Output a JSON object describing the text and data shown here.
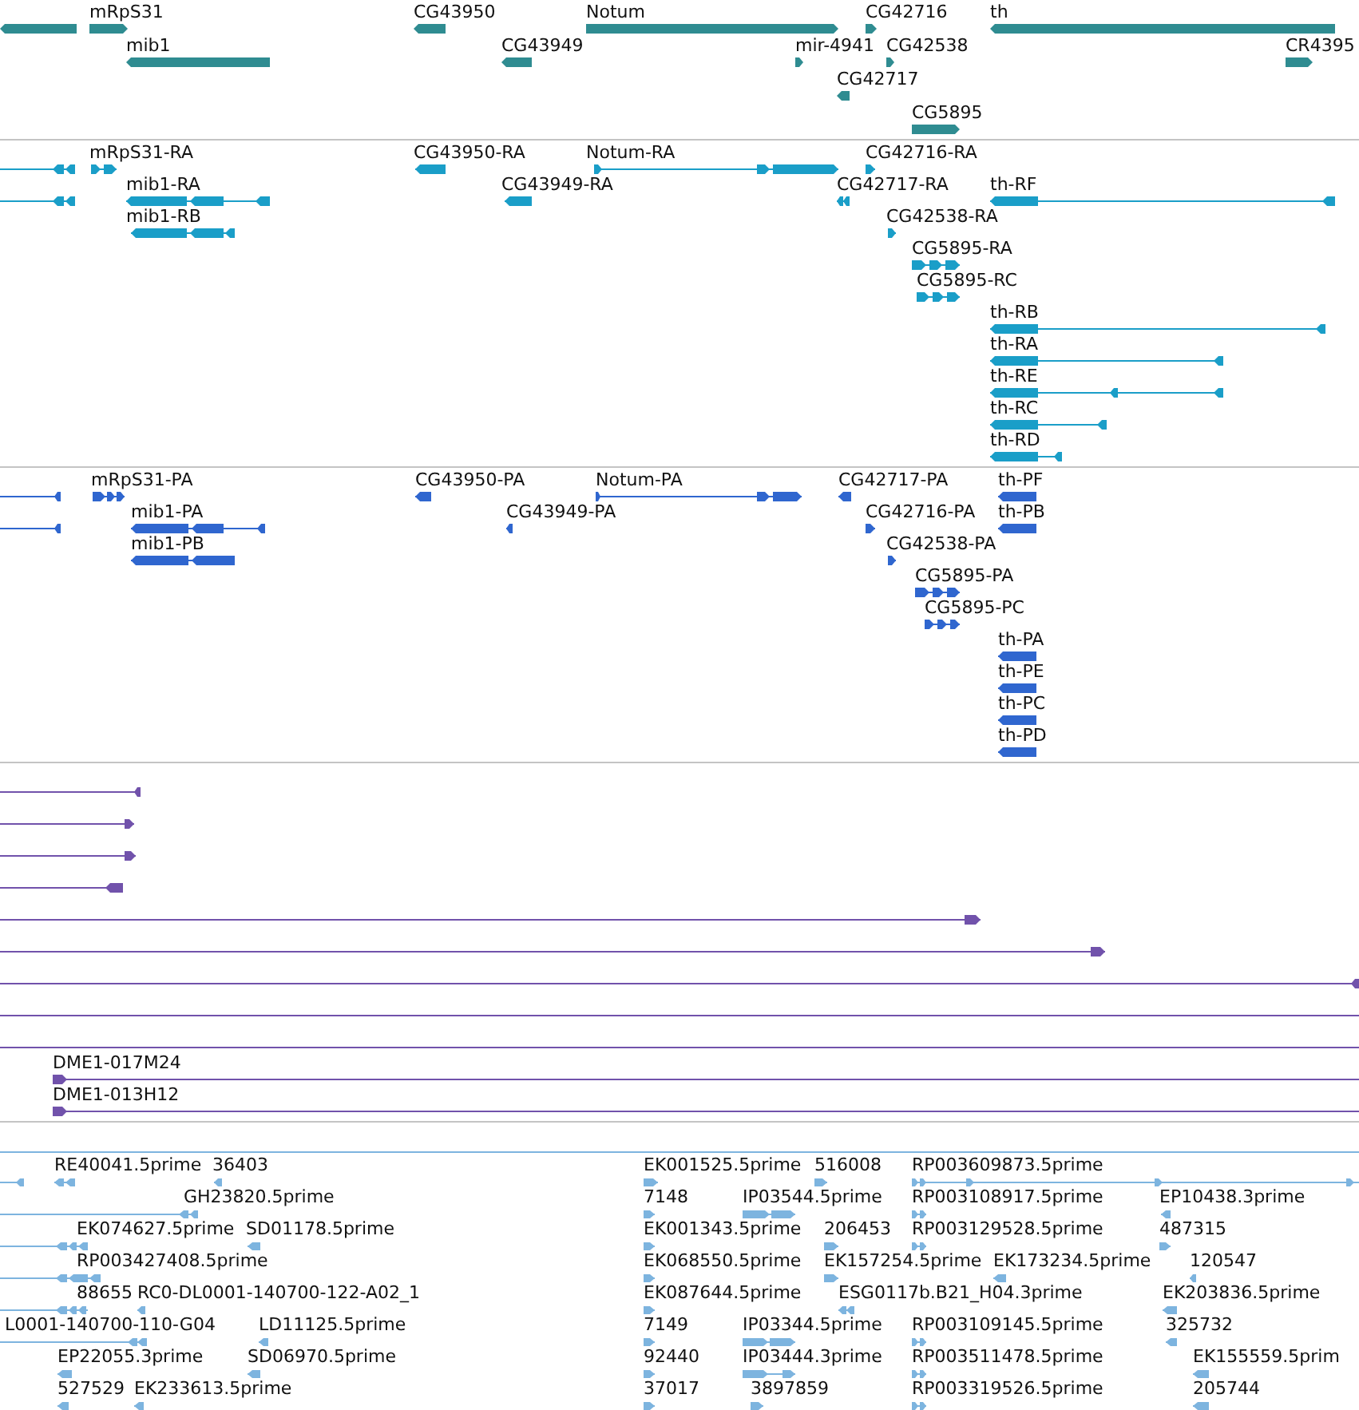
{
  "tracks": [
    {
      "kind": "gene",
      "features": [
        {
          "forward": false
        },
        {
          "label": "mRpS31",
          "forward": true
        },
        {
          "label": "mib1",
          "forward": false
        },
        {
          "label": "CG43950",
          "forward": false
        },
        {
          "label": "CG43949",
          "forward": false
        },
        {
          "label": "Notum",
          "forward": true
        },
        {
          "label": "mir-4941",
          "forward": true
        },
        {
          "label": "CG42716",
          "forward": true
        },
        {
          "label": "CG42538",
          "forward": true
        },
        {
          "label": "CG42717",
          "forward": false
        },
        {
          "label": "CG5895",
          "forward": true
        },
        {
          "label": "th",
          "forward": false
        },
        {
          "label": "CR4395",
          "forward": true
        }
      ]
    },
    {
      "kind": "transcript",
      "features": [
        {
          "forward": false
        },
        {
          "forward": false
        },
        {
          "label": "mRpS31-RA",
          "forward": true
        },
        {
          "label": "mib1-RA",
          "forward": false
        },
        {
          "label": "mib1-RB",
          "forward": false
        },
        {
          "label": "CG43950-RA",
          "forward": false
        },
        {
          "label": "CG43949-RA",
          "forward": false
        },
        {
          "label": "Notum-RA",
          "forward": true
        },
        {
          "label": "CG42716-RA",
          "forward": true
        },
        {
          "label": "CG42717-RA",
          "forward": false
        },
        {
          "label": "th-RF",
          "forward": false
        },
        {
          "label": "CG42538-RA",
          "forward": true
        },
        {
          "label": "CG5895-RA",
          "forward": true
        },
        {
          "label": "CG5895-RC",
          "forward": true
        },
        {
          "label": "th-RB",
          "forward": false
        },
        {
          "label": "th-RA",
          "forward": false
        },
        {
          "label": "th-RE",
          "forward": false
        },
        {
          "label": "th-RC",
          "forward": false
        },
        {
          "label": "th-RD",
          "forward": false
        }
      ]
    },
    {
      "kind": "protein",
      "features": [
        {
          "forward": false
        },
        {
          "forward": false
        },
        {
          "label": "mRpS31-PA",
          "forward": true
        },
        {
          "label": "mib1-PA",
          "forward": false
        },
        {
          "label": "mib1-PB",
          "forward": false
        },
        {
          "label": "CG43950-PA",
          "forward": false
        },
        {
          "label": "CG43949-PA",
          "forward": false
        },
        {
          "label": "Notum-PA",
          "forward": true
        },
        {
          "label": "CG42717-PA",
          "forward": false
        },
        {
          "label": "CG42716-PA",
          "forward": true
        },
        {
          "label": "th-PF",
          "forward": false
        },
        {
          "label": "th-PB",
          "forward": false
        },
        {
          "label": "CG42538-PA",
          "forward": true
        },
        {
          "label": "CG5895-PA",
          "forward": true
        },
        {
          "label": "CG5895-PC",
          "forward": true
        },
        {
          "label": "th-PA",
          "forward": false
        },
        {
          "label": "th-PE",
          "forward": false
        },
        {
          "label": "th-PC",
          "forward": false
        },
        {
          "label": "th-PD",
          "forward": false
        }
      ]
    },
    {
      "kind": "clone",
      "features": [
        {
          "kind": "arrow",
          "forward": false
        },
        {
          "kind": "arrow",
          "forward": true
        },
        {
          "kind": "arrow",
          "forward": true
        },
        {
          "kind": "arrow",
          "forward": false
        },
        {
          "kind": "arrow",
          "forward": true
        },
        {
          "kind": "arrow",
          "forward": true
        },
        {
          "kind": "arrow",
          "forward": false
        },
        {
          "kind": "plain"
        },
        {
          "kind": "plain"
        },
        {
          "kind": "arrow",
          "label": "DME1-017M24",
          "forward": true
        },
        {
          "kind": "arrow",
          "label": "DME1-013H12",
          "forward": true
        }
      ]
    },
    {
      "kind": "est",
      "features": [
        {
          "forward": false
        },
        {
          "label": "RE40041.5prime",
          "forward": false
        },
        {
          "label": "36403",
          "forward": false
        },
        {
          "label": "EK001525.5prime",
          "forward": true
        },
        {
          "label": "516008",
          "forward": true
        },
        {
          "label": "RP003609873.5prime",
          "forward": true
        },
        {
          "label": "GH23820.5prime",
          "forward": false
        },
        {
          "label": "7148",
          "forward": true
        },
        {
          "label": "IP03544.5prime",
          "forward": true
        },
        {
          "label": "RP003108917.5prime",
          "forward": true
        },
        {
          "label": "EP10438.3prime",
          "forward": false
        },
        {
          "label": "EK074627.5prime",
          "forward": false
        },
        {
          "label": "SD01178.5prime",
          "forward": false
        },
        {
          "label": "EK001343.5prime",
          "forward": true
        },
        {
          "label": "206453",
          "forward": true
        },
        {
          "label": "RP003129528.5prime",
          "forward": true
        },
        {
          "label": "487315",
          "forward": true
        },
        {
          "label": "RP003427408.5prime",
          "forward": false
        },
        {
          "label": "EK068550.5prime",
          "forward": true
        },
        {
          "label": "EK157254.5prime",
          "forward": true
        },
        {
          "label": "EK173234.5prime",
          "forward": false
        },
        {
          "label": "120547",
          "forward": false
        },
        {
          "label": "88655",
          "forward": false
        },
        {
          "label": "RC0-DL0001-140700-122-A02_1",
          "forward": false
        },
        {
          "label": "EK087644.5prime",
          "forward": true
        },
        {
          "label": "ESG0117b.B21_H04.3prime",
          "forward": false
        },
        {
          "label": "EK203836.5prime",
          "forward": false
        },
        {
          "label": "L0001-140700-110-G04",
          "forward": false
        },
        {
          "label": "LD11125.5prime",
          "forward": false
        },
        {
          "label": "7149",
          "forward": true
        },
        {
          "label": "IP03344.5prime",
          "forward": true
        },
        {
          "label": "RP003109145.5prime",
          "forward": true
        },
        {
          "label": "325732",
          "forward": false
        },
        {
          "label": "EP22055.3prime",
          "forward": false
        },
        {
          "label": "SD06970.5prime",
          "forward": false
        },
        {
          "label": "92440",
          "forward": true
        },
        {
          "label": "IP03444.3prime",
          "forward": true
        },
        {
          "label": "RP003511478.5prime",
          "forward": true
        },
        {
          "label": "EK155559.5prim",
          "forward": false
        },
        {
          "label": "527529",
          "forward": false
        },
        {
          "label": "EK233613.5prime",
          "forward": false
        },
        {
          "label": "37017",
          "forward": true
        },
        {
          "label": "3897859",
          "forward": true
        },
        {
          "label": "RP003319526.5prime",
          "forward": true
        },
        {
          "label": "205744",
          "forward": false
        }
      ]
    }
  ]
}
